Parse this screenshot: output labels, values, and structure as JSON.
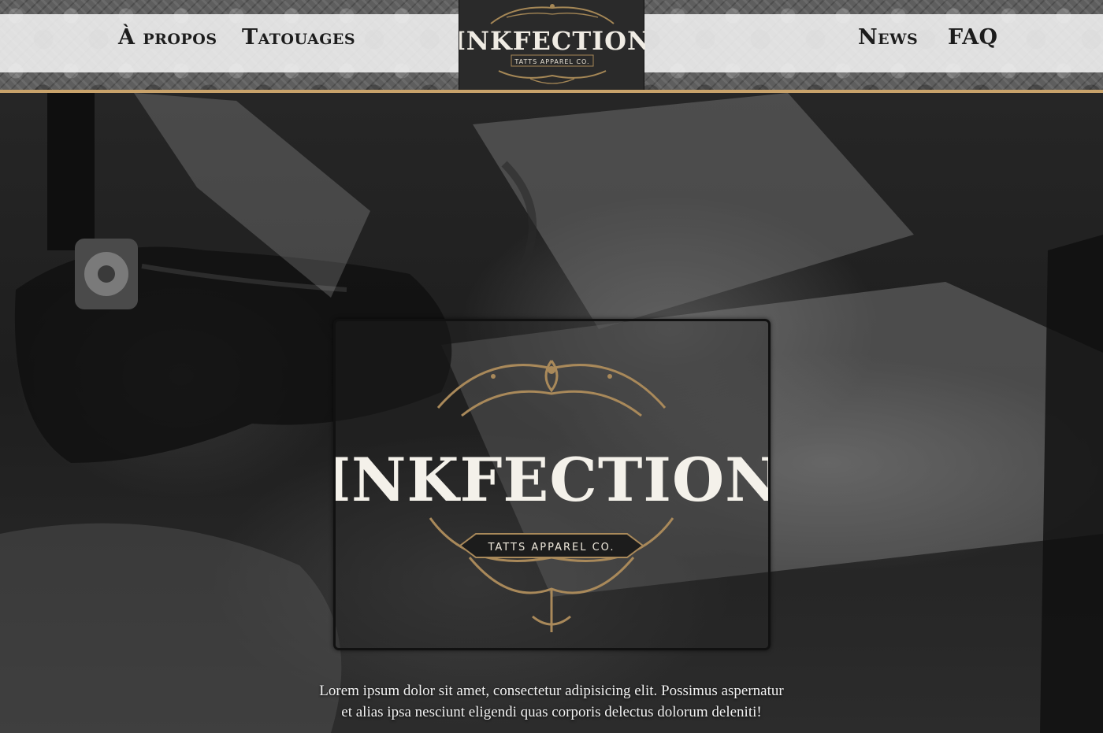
{
  "nav": {
    "left": [
      {
        "label": "À propos"
      },
      {
        "label": "Tatouages"
      }
    ],
    "right": [
      {
        "label": "News"
      },
      {
        "label": "FAQ"
      }
    ]
  },
  "brand": {
    "name": "INKFECTION",
    "tagline": "TATTS APPAREL CO."
  },
  "hero": {
    "description": "Lorem ipsum dolor sit amet, consectetur adipisicing elit. Possimus aspernatur et alias ipsa nesciunt eligendi quas corporis delectus dolorum deleniti!"
  },
  "colors": {
    "accent_gold": "#c9a36b",
    "nav_text": "#1c1c1c",
    "hero_text": "#f2f2f2"
  }
}
